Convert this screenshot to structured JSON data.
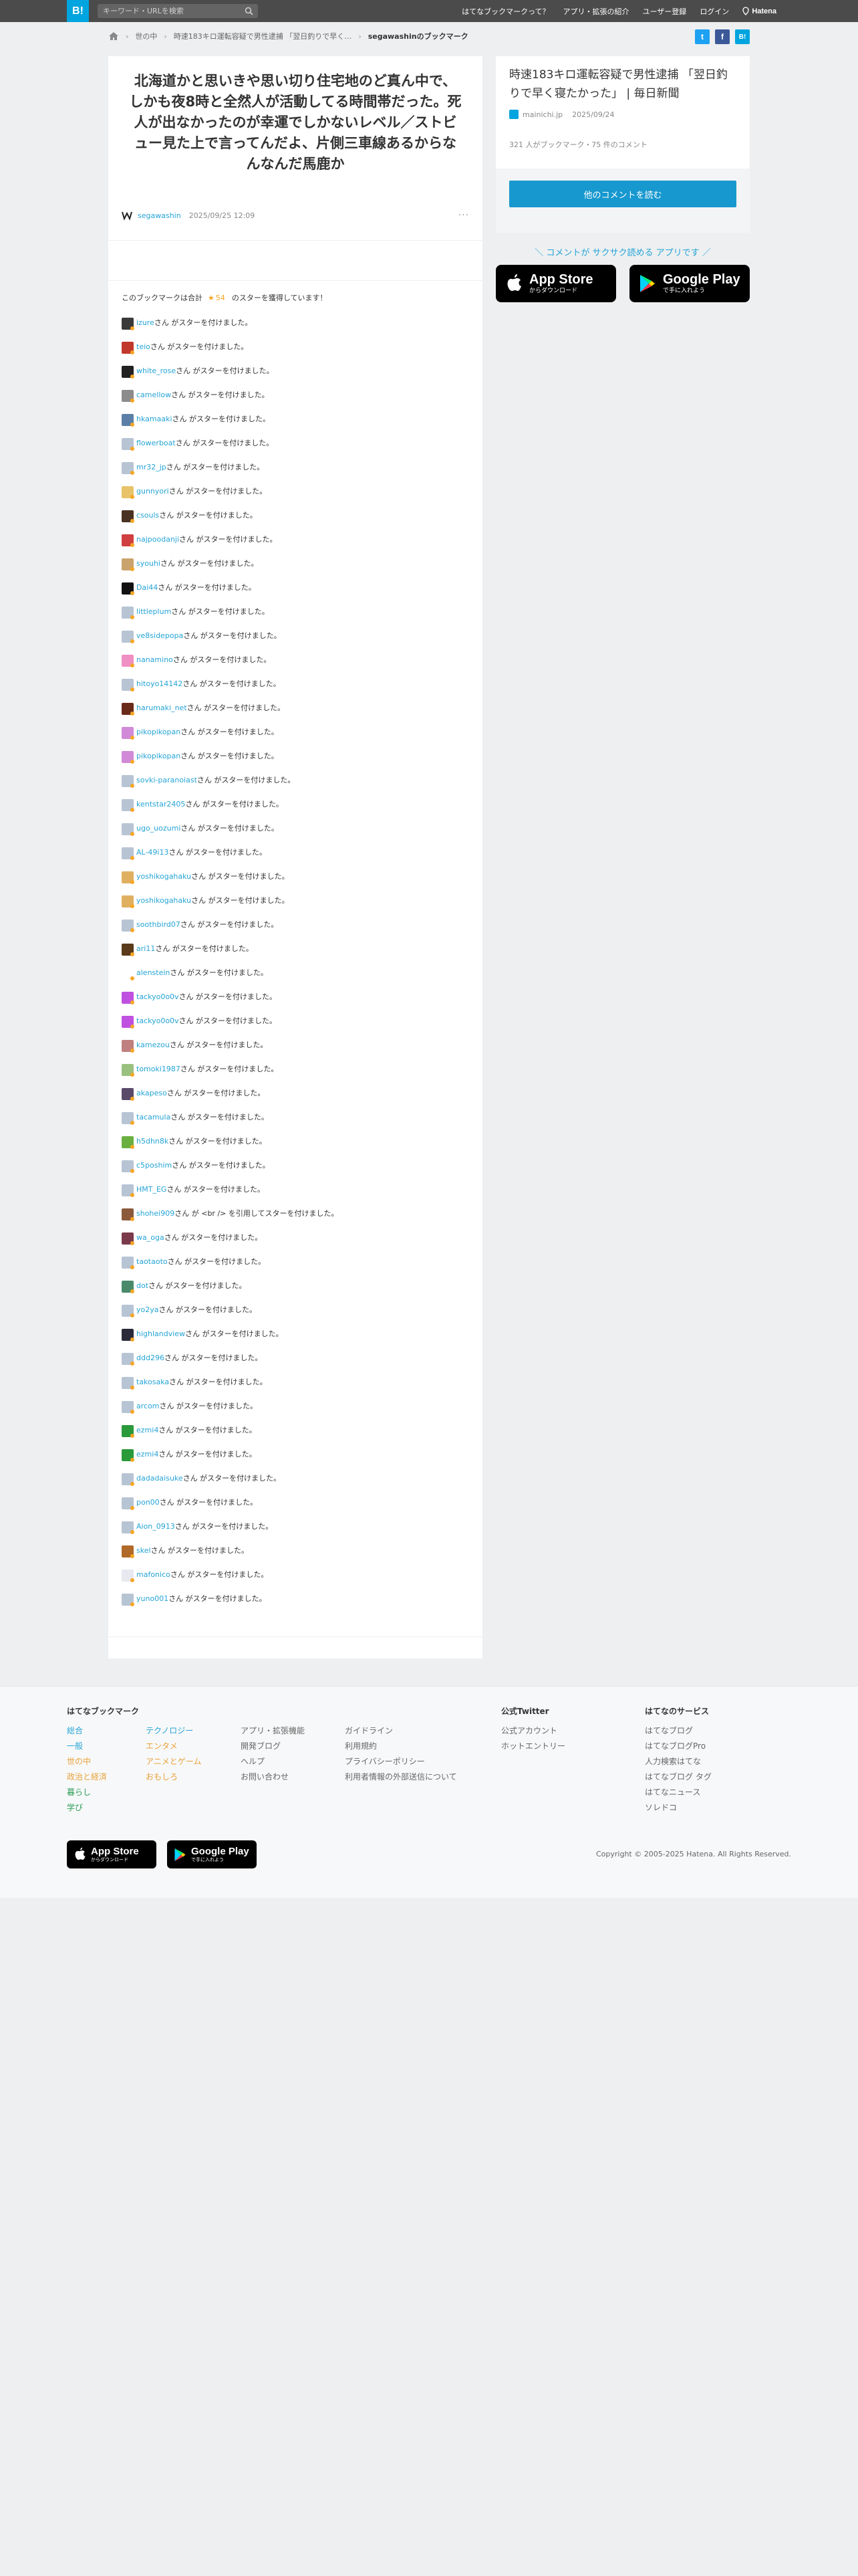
{
  "topbar": {
    "logo": "B!",
    "search_placeholder": "キーワード・URLを検索",
    "nav": [
      "はてなブックマークって？",
      "アプリ・拡張の紹介",
      "ユーザー登録",
      "ログイン"
    ],
    "brand": "Hatena"
  },
  "breadcrumb": {
    "items": [
      "世の中",
      "時速183キロ運転容疑で男性逮捕 「翌日釣りで早く…"
    ],
    "current": "segawashinのブックマーク"
  },
  "shares": {
    "twitter": "t",
    "facebook": "f",
    "hatena": "B!"
  },
  "bookmark": {
    "comment": "北海道かと思いきや思い切り住宅地のど真ん中で、しかも夜8時と全然人が活動してる時間帯だった。死人が出なかったのが幸運でしかないレベル／ストビュー見た上で言ってんだよ、片側三車線あるからなんなんだ馬鹿か",
    "user": "segawashin",
    "date": "2025/09/25 12:09",
    "more": "···"
  },
  "star_summary": {
    "prefix": "このブックマークは合計",
    "star": "★",
    "count": "54",
    "suffix": "のスターを獲得しています！"
  },
  "stars": [
    {
      "user": "izure",
      "text": "さん がスターを付けました。",
      "color": "#3a3a3a"
    },
    {
      "user": "teio",
      "text": "さん がスターを付けました。",
      "color": "#c0392b"
    },
    {
      "user": "white_rose",
      "text": "さん がスターを付けました。",
      "color": "#222222"
    },
    {
      "user": "camellow",
      "text": "さん がスターを付けました。",
      "color": "#8c8c8c"
    },
    {
      "user": "hkamaaki",
      "text": "さん がスターを付けました。",
      "color": "#5b7fa6"
    },
    {
      "user": "flowerboat",
      "text": "さん がスターを付けました。",
      "color": "#b7c4d4"
    },
    {
      "user": "mr32_jp",
      "text": "さん がスターを付けました。",
      "color": "#b7c4d4"
    },
    {
      "user": "gunnyori",
      "text": "さん がスターを付けました。",
      "color": "#e8c36a"
    },
    {
      "user": "csouls",
      "text": "さん がスターを付けました。",
      "color": "#4a3222"
    },
    {
      "user": "najpoodanji",
      "text": "さん がスターを付けました。",
      "color": "#d04040"
    },
    {
      "user": "syouhi",
      "text": "さん がスターを付けました。",
      "color": "#c9a36b"
    },
    {
      "user": "Dai44",
      "text": "さん がスターを付けました。",
      "color": "#111111"
    },
    {
      "user": "littleplum",
      "text": "さん がスターを付けました。",
      "color": "#b7c4d4"
    },
    {
      "user": "ve8sidepopa",
      "text": "さん がスターを付けました。",
      "color": "#b7c4d4"
    },
    {
      "user": "nanamino",
      "text": "さん がスターを付けました。",
      "color": "#f08fc4"
    },
    {
      "user": "hitoyo14142",
      "text": "さん がスターを付けました。",
      "color": "#b7c4d4"
    },
    {
      "user": "harumaki_net",
      "text": "さん がスターを付けました。",
      "color": "#6a2a1a"
    },
    {
      "user": "pikopikopan",
      "text": "さん がスターを付けました。",
      "color": "#d08ad8"
    },
    {
      "user": "pikopikopan",
      "text": "さん がスターを付けました。",
      "color": "#d08ad8"
    },
    {
      "user": "sovki-paranoiast",
      "text": "さん がスターを付けました。",
      "color": "#b7c4d4"
    },
    {
      "user": "kentstar2405",
      "text": "さん がスターを付けました。",
      "color": "#b7c4d4"
    },
    {
      "user": "ugo_uozumi",
      "text": "さん がスターを付けました。",
      "color": "#b7c4d4"
    },
    {
      "user": "AL-49i13",
      "text": "さん がスターを付けました。",
      "color": "#b7c4d4"
    },
    {
      "user": "yoshikogahaku",
      "text": "さん がスターを付けました。",
      "color": "#e0b060"
    },
    {
      "user": "yoshikogahaku",
      "text": "さん がスターを付けました。",
      "color": "#e0b060"
    },
    {
      "user": "soothbird07",
      "text": "さん がスターを付けました。",
      "color": "#b7c4d4"
    },
    {
      "user": "ari11",
      "text": "さん がスターを付けました。",
      "color": "#5a3a1a"
    },
    {
      "user": "alenstein",
      "text": "さん がスターを付けました。",
      "color": "#ffffff"
    },
    {
      "user": "tackyo0o0v",
      "text": "さん がスターを付けました。",
      "color": "#c050e0"
    },
    {
      "user": "tackyo0o0v",
      "text": "さん がスターを付けました。",
      "color": "#c050e0"
    },
    {
      "user": "kamezou",
      "text": "さん がスターを付けました。",
      "color": "#c08080"
    },
    {
      "user": "tomoki1987",
      "text": "さん がスターを付けました。",
      "color": "#9ac080"
    },
    {
      "user": "akapeso",
      "text": "さん がスターを付けました。",
      "color": "#5a4a6a"
    },
    {
      "user": "tacamula",
      "text": "さん がスターを付けました。",
      "color": "#b7c4d4"
    },
    {
      "user": "h5dhn8k",
      "text": "さん がスターを付けました。",
      "color": "#6ab040"
    },
    {
      "user": "c5poshim",
      "text": "さん がスターを付けました。",
      "color": "#b7c4d4"
    },
    {
      "user": "HMT_EG",
      "text": "さん がスターを付けました。",
      "color": "#b7c4d4"
    },
    {
      "user": "shohei909",
      "text": "さん が <br /> を引用してスターを付けました。",
      "color": "#8a5a3a"
    },
    {
      "user": "wa_oga",
      "text": "さん がスターを付けました。",
      "color": "#7a3a4a"
    },
    {
      "user": "taotaoto",
      "text": "さん がスターを付けました。",
      "color": "#b7c4d4"
    },
    {
      "user": "dot",
      "text": "さん がスターを付けました。",
      "color": "#4a8a6a"
    },
    {
      "user": "yo2ya",
      "text": "さん がスターを付けました。",
      "color": "#b7c4d4"
    },
    {
      "user": "highlandview",
      "text": "さん がスターを付けました。",
      "color": "#2a2a3a"
    },
    {
      "user": "ddd296",
      "text": "さん がスターを付けました。",
      "color": "#b7c4d4"
    },
    {
      "user": "takosaka",
      "text": "さん がスターを付けました。",
      "color": "#b7c4d4"
    },
    {
      "user": "arcom",
      "text": "さん がスターを付けました。",
      "color": "#b7c4d4"
    },
    {
      "user": "ezmi4",
      "text": "さん がスターを付けました。",
      "color": "#2a9a3a"
    },
    {
      "user": "ezmi4",
      "text": "さん がスターを付けました。",
      "color": "#2a9a3a"
    },
    {
      "user": "dadadaisuke",
      "text": "さん がスターを付けました。",
      "color": "#b7c4d4"
    },
    {
      "user": "pon00",
      "text": "さん がスターを付けました。",
      "color": "#b7c4d4"
    },
    {
      "user": "Aion_0913",
      "text": "さん がスターを付けました。",
      "color": "#b7c4d4"
    },
    {
      "user": "skel",
      "text": "さん がスターを付けました。",
      "color": "#b06a2a"
    },
    {
      "user": "mafonico",
      "text": "さん がスターを付けました。",
      "color": "#e8e8f0"
    },
    {
      "user": "yuno001",
      "text": "さん がスターを付けました。",
      "color": "#b7c4d4"
    }
  ],
  "sidebar": {
    "title": "時速183キロ運転容疑で男性逮捕 「翌日釣りで早く寝たかった」 | 毎日新聞",
    "source": "mainichi.jp",
    "date": "2025/09/24",
    "stats": "321 人がブックマーク・75 件のコメント",
    "button": "他のコメントを読む",
    "app_note": "＼ コメントが サクサク読める アプリです ／"
  },
  "apps": {
    "appstore_title": "App Store",
    "appstore_sub": "からダウンロード",
    "google_title": "Google Play",
    "google_sub": "で手に入れよう"
  },
  "footer": {
    "col1_title": "はてなブックマーク",
    "col1a": [
      "総合",
      "一般",
      "世の中",
      "政治と経済",
      "暮らし",
      "学び"
    ],
    "col1b": [
      "テクノロジー",
      "エンタメ",
      "アニメとゲーム",
      "おもしろ"
    ],
    "col1c": [
      "アプリ・拡張機能",
      "開発ブログ",
      "ヘルプ",
      "お問い合わせ"
    ],
    "col1d": [
      "ガイドライン",
      "利用規約",
      "プライバシーポリシー",
      "利用者情報の外部送信について"
    ],
    "col2_title": "公式Twitter",
    "col2": [
      "公式アカウント",
      "ホットエントリー"
    ],
    "col3_title": "はてなのサービス",
    "col3": [
      "はてなブログ",
      "はてなブログPro",
      "人力検索はてな",
      "はてなブログ タグ",
      "はてなニュース",
      "ソレドコ"
    ],
    "copyright": "Copyright © 2005-2025 Hatena. All Rights Reserved."
  }
}
